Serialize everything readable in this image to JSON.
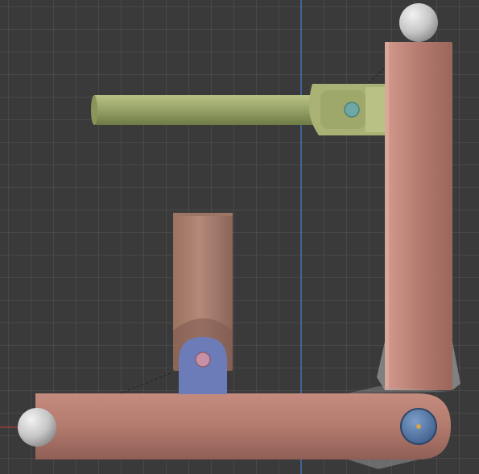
{
  "viewport": {
    "background": "#3a3a3a",
    "grid_color": "#4a4a4a",
    "axis_y_color": "#3d6fb5",
    "axis_x_color": "#9b3a3a"
  },
  "scene": {
    "objects": [
      {
        "name": "top-horizontal-rod",
        "color": "#9aa56b",
        "shape": "cylinder"
      },
      {
        "name": "top-joint-bracket",
        "color": "#b5bd7a",
        "shape": "clevis"
      },
      {
        "name": "top-joint-pin",
        "color": "#6fa7a4",
        "shape": "pin"
      },
      {
        "name": "right-vertical-link",
        "color": "#b57b70",
        "shape": "box"
      },
      {
        "name": "bottom-horizontal-link",
        "color": "#b57b70",
        "shape": "box"
      },
      {
        "name": "bottom-right-pin",
        "color": "#4a6d9a",
        "shape": "pin"
      },
      {
        "name": "small-vertical-rod",
        "color": "#a87a6a",
        "shape": "cylinder"
      },
      {
        "name": "small-rod-bracket",
        "color": "#6b7cb8",
        "shape": "clevis"
      },
      {
        "name": "small-rod-pin",
        "color": "#c890a5",
        "shape": "pin"
      },
      {
        "name": "top-sphere",
        "color": "#cfcfcf",
        "shape": "sphere"
      },
      {
        "name": "left-sphere",
        "color": "#cfcfcf",
        "shape": "sphere"
      }
    ]
  }
}
